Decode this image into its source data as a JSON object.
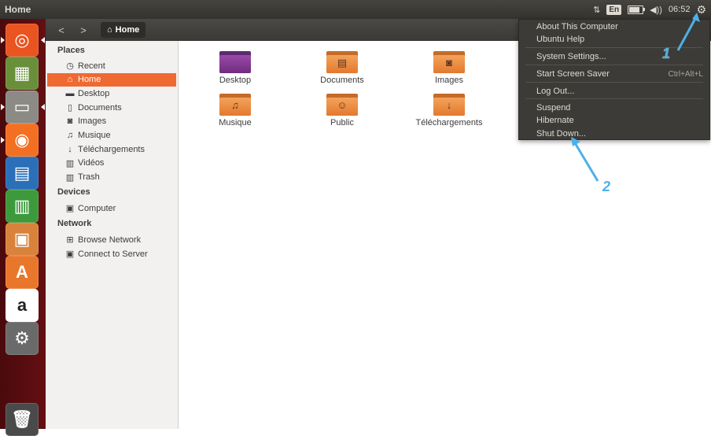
{
  "window": {
    "title": "Home"
  },
  "top_panel": {
    "network_icon": "updown-arrows-icon",
    "language": "En",
    "battery_level_percent": 80,
    "volume_icon": "speaker-icon",
    "clock": "06:52",
    "session_icon": "gear-icon"
  },
  "launcher": {
    "items": [
      {
        "name": "dash-home",
        "icon": "ubuntu-logo-icon",
        "glyph": "◎"
      },
      {
        "name": "image-viewer",
        "icon": "image-viewer-icon",
        "glyph": "▦"
      },
      {
        "name": "files",
        "icon": "file-cabinet-icon",
        "glyph": "▭"
      },
      {
        "name": "firefox",
        "icon": "firefox-icon",
        "glyph": "◉"
      },
      {
        "name": "writer",
        "icon": "writer-icon",
        "glyph": "▤"
      },
      {
        "name": "calc",
        "icon": "calc-icon",
        "glyph": "▥"
      },
      {
        "name": "impress",
        "icon": "impress-icon",
        "glyph": "▣"
      },
      {
        "name": "software-center",
        "icon": "shopping-bag-icon",
        "glyph": "A"
      },
      {
        "name": "amazon",
        "icon": "amazon-icon",
        "glyph": "a"
      },
      {
        "name": "system-settings",
        "icon": "settings-tools-icon",
        "glyph": "⚙"
      },
      {
        "name": "trash",
        "icon": "trash-icon",
        "glyph": "🗑"
      }
    ]
  },
  "toolbar": {
    "back": "<",
    "forward": ">",
    "path": "Home",
    "path_icon": "home-icon"
  },
  "sidebar": {
    "places_header": "Places",
    "places": [
      {
        "label": "Recent",
        "icon": "clock-icon",
        "glyph": "◷"
      },
      {
        "label": "Home",
        "icon": "home-icon",
        "glyph": "⌂"
      },
      {
        "label": "Desktop",
        "icon": "desktop-folder-icon",
        "glyph": "▬"
      },
      {
        "label": "Documents",
        "icon": "document-icon",
        "glyph": "▯"
      },
      {
        "label": "Images",
        "icon": "camera-icon",
        "glyph": "◙"
      },
      {
        "label": "Musique",
        "icon": "music-icon",
        "glyph": "♫"
      },
      {
        "label": "Téléchargements",
        "icon": "download-icon",
        "glyph": "↓"
      },
      {
        "label": "Vidéos",
        "icon": "film-icon",
        "glyph": "▥"
      },
      {
        "label": "Trash",
        "icon": "trash-icon",
        "glyph": "▥"
      }
    ],
    "devices_header": "Devices",
    "devices": [
      {
        "label": "Computer",
        "icon": "computer-icon",
        "glyph": "▣"
      }
    ],
    "network_header": "Network",
    "network": [
      {
        "label": "Browse Network",
        "icon": "network-icon",
        "glyph": "⊞"
      },
      {
        "label": "Connect to Server",
        "icon": "server-icon",
        "glyph": "▣"
      }
    ]
  },
  "content": {
    "folders": [
      {
        "label": "Desktop",
        "icon": "desktop-folder-icon",
        "emblem": ""
      },
      {
        "label": "Documents",
        "icon": "documents-folder-icon",
        "emblem": "▤"
      },
      {
        "label": "Images",
        "icon": "images-folder-icon",
        "emblem": "◙"
      },
      {
        "label": "Musique",
        "icon": "music-folder-icon",
        "emblem": "♫"
      },
      {
        "label": "Public",
        "icon": "public-folder-icon",
        "emblem": "☺"
      },
      {
        "label": "Téléchargements",
        "icon": "downloads-folder-icon",
        "emblem": "↓"
      }
    ]
  },
  "session_menu": {
    "items": [
      {
        "label": "About This Computer",
        "shortcut": ""
      },
      {
        "label": "Ubuntu Help",
        "shortcut": ""
      },
      {
        "label": "System Settings...",
        "shortcut": ""
      },
      {
        "label": "Start Screen Saver",
        "shortcut": "Ctrl+Alt+L"
      },
      {
        "label": "Log Out...",
        "shortcut": ""
      },
      {
        "label": "Suspend",
        "shortcut": ""
      },
      {
        "label": "Hibernate",
        "shortcut": ""
      },
      {
        "label": "Shut Down...",
        "shortcut": ""
      }
    ]
  },
  "annotations": {
    "step1": "1",
    "step2": "2",
    "color": "#4db0e8"
  }
}
